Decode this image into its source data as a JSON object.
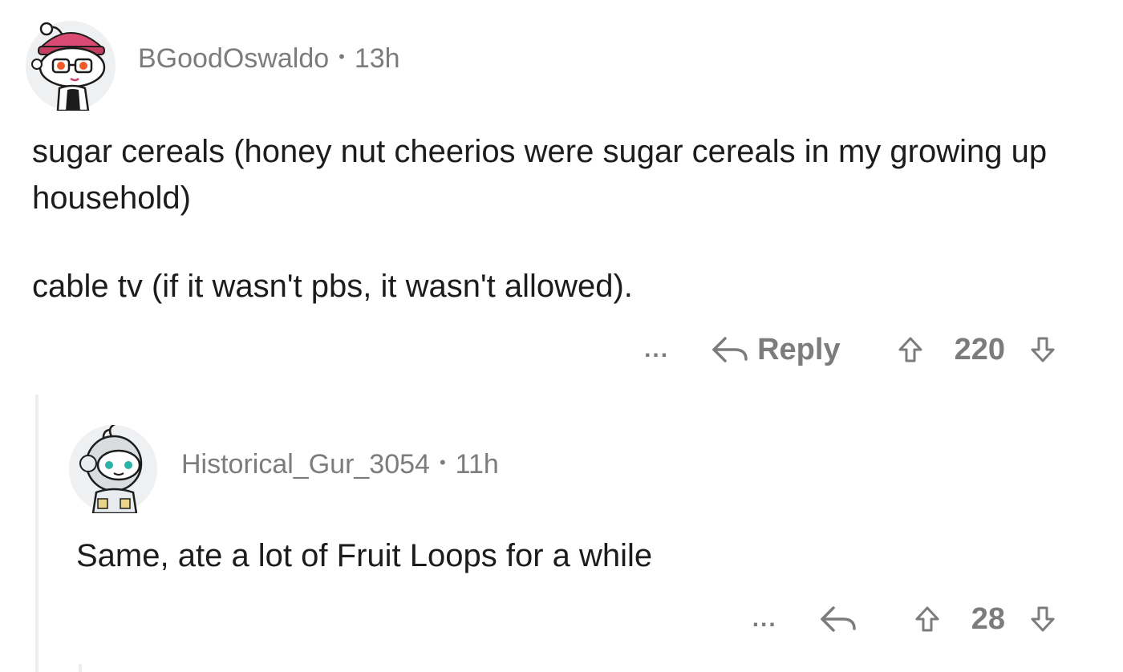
{
  "parent": {
    "username": "BGoodOswaldo",
    "separator": "•",
    "time": "13h",
    "paragraphs": [
      "sugar cereals (honey nut cheerios were sugar cereals in my growing up household)",
      "cable tv (if it wasn't pbs, it wasn't allowed)."
    ],
    "more_label": "...",
    "reply_label": "Reply",
    "score": "220"
  },
  "child": {
    "username": "Historical_Gur_3054",
    "separator": "•",
    "time": "11h",
    "paragraphs": [
      "Same, ate a lot of Fruit Loops for a while"
    ],
    "more_label": "...",
    "score": "28"
  },
  "colors": {
    "meta_text": "#7c7c7c",
    "body_text": "#1c1c1c",
    "thread_line": "#ededed"
  },
  "icons": {
    "reply": "reply-arrow-icon",
    "upvote": "upvote-arrow-icon",
    "downvote": "downvote-arrow-icon",
    "more": "more-dots-icon"
  }
}
